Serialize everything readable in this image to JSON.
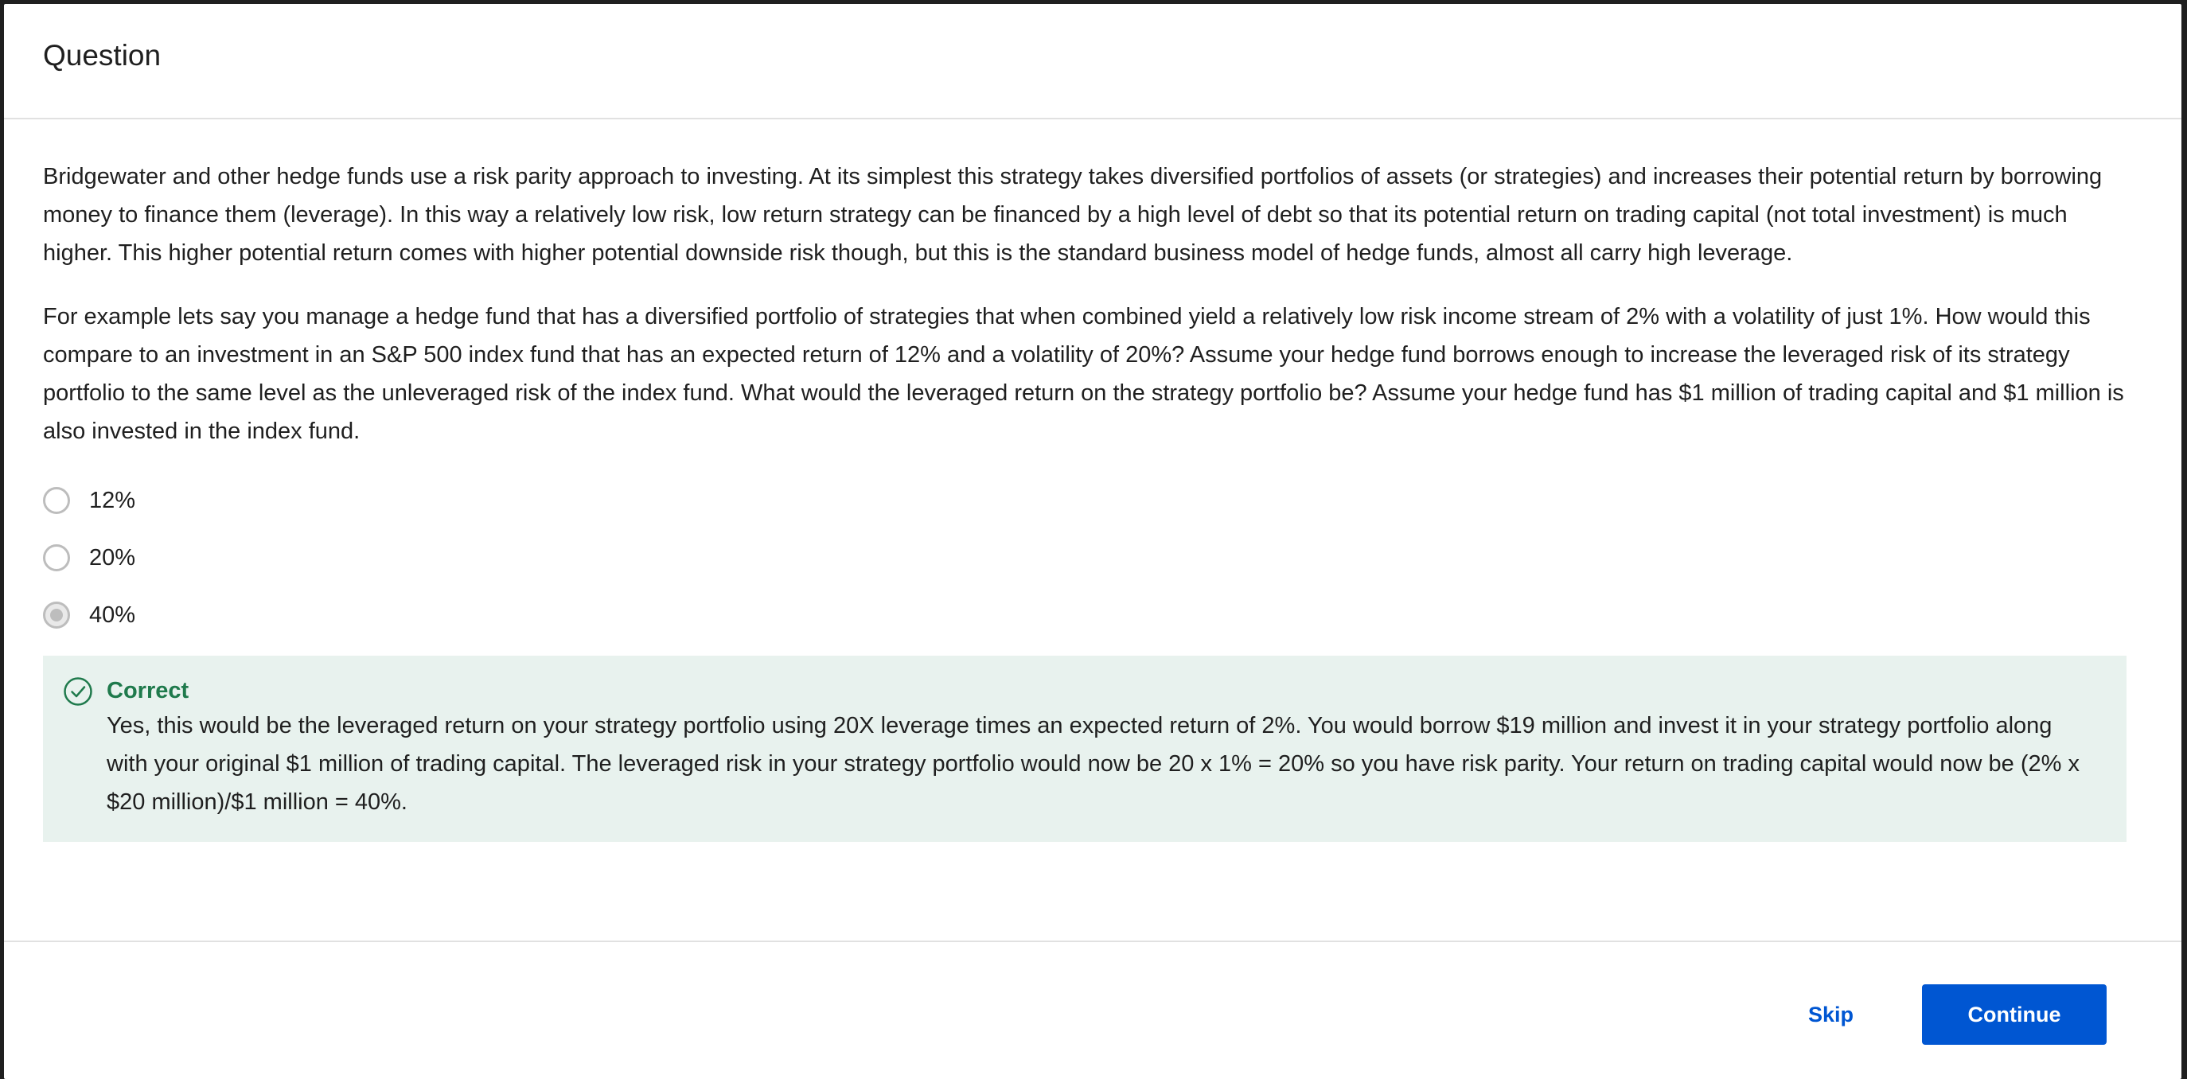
{
  "header": {
    "title": "Question"
  },
  "question": {
    "paragraphs": [
      "Bridgewater and other hedge funds use a risk parity approach to investing. At its simplest this strategy takes diversified portfolios of assets (or strategies) and increases their potential return by borrowing money to finance them (leverage). In this way a relatively low risk, low return strategy can be financed by a high level of debt so that its potential return on trading capital (not total investment) is much higher. This higher potential return comes with higher potential downside risk though, but this is the standard business model of hedge funds, almost all carry high leverage.",
      "For example lets say you manage a hedge fund that has a diversified portfolio of strategies that when combined yield a relatively low risk income stream of 2% with a volatility of just 1%. How would this compare to an investment in an S&P 500 index fund that has an expected return of 12% and a volatility of 20%? Assume your hedge fund  borrows enough to increase the leveraged risk of its strategy portfolio to the same level as the unleveraged risk of the index fund. What would the leveraged return on the strategy portfolio be? Assume your hedge fund has $1 million of trading capital and $1 million is also invested in the index fund."
    ],
    "options": [
      {
        "label": "12%",
        "selected": false
      },
      {
        "label": "20%",
        "selected": false
      },
      {
        "label": "40%",
        "selected": true
      }
    ]
  },
  "feedback": {
    "status": "Correct",
    "icon": "check-circle-icon",
    "color": "#1f7a4c",
    "background": "#e8f2ee",
    "text": "Yes, this would be the leveraged return on your strategy portfolio using 20X leverage times an expected return of 2%. You would borrow $19 million and invest it in your strategy portfolio along with your original $1 million of trading capital. The leveraged risk in your strategy portfolio would now be 20 x 1% = 20% so you have risk parity. Your return on trading capital would now be (2% x $20 million)/$1 million = 40%."
  },
  "footer": {
    "skip_label": "Skip",
    "continue_label": "Continue",
    "accent": "#0056d2"
  }
}
